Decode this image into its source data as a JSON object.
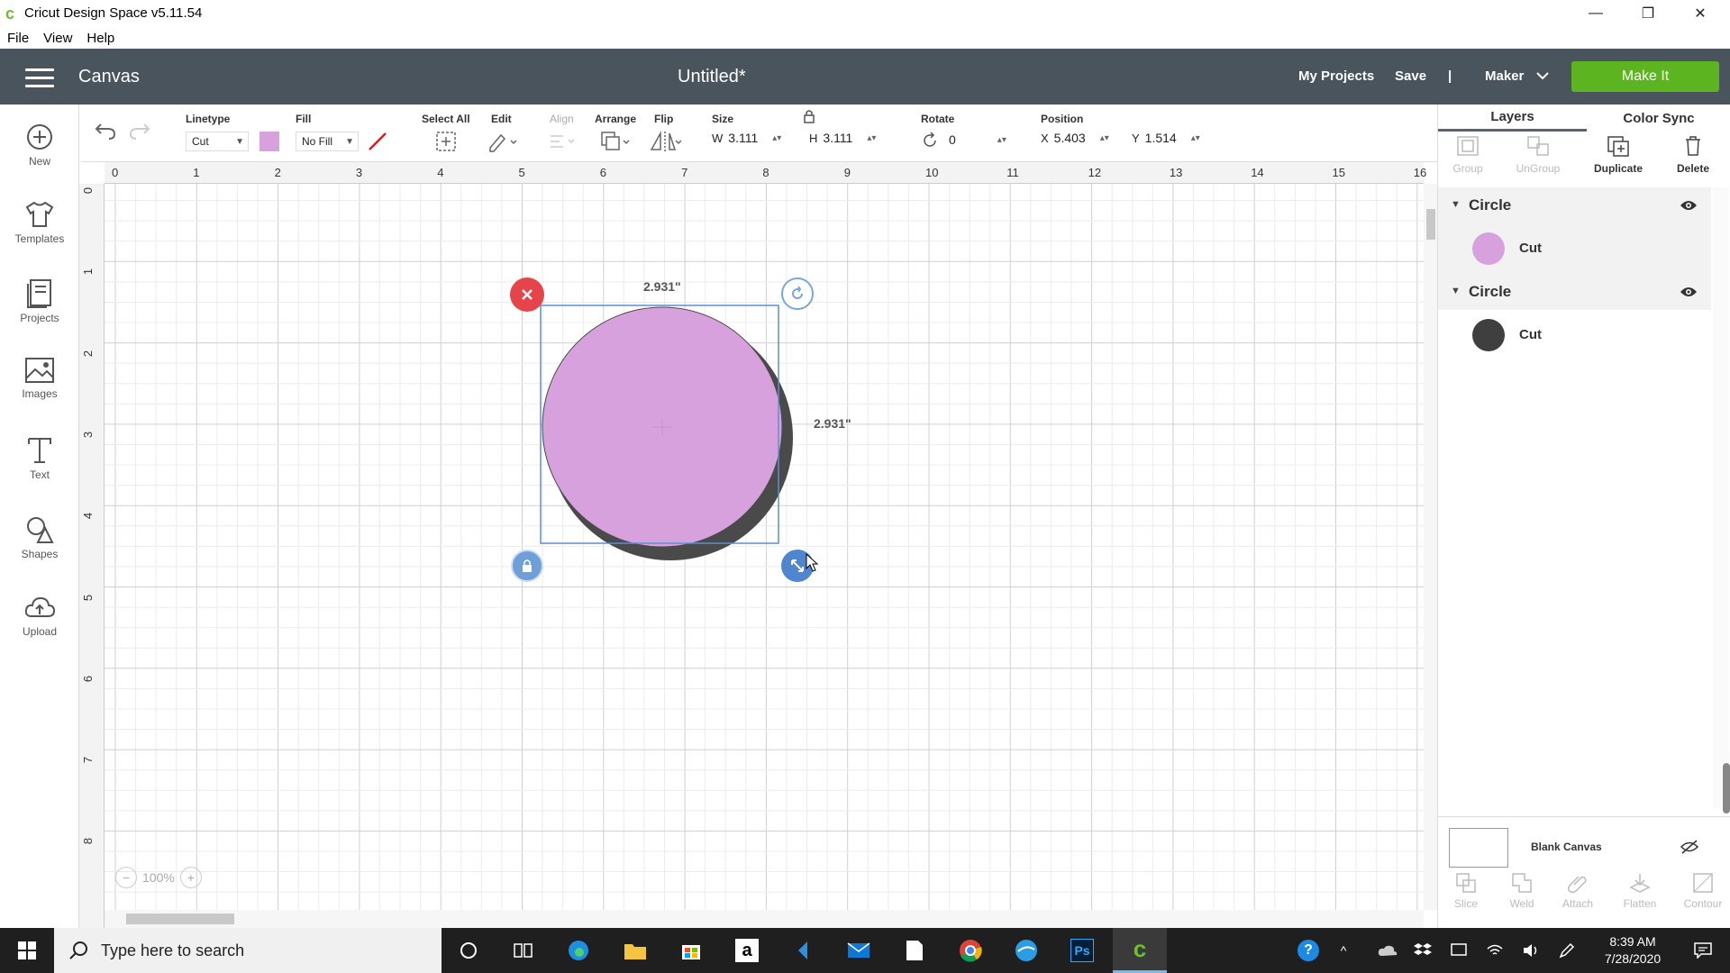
{
  "window": {
    "title": "Cricut Design Space  v5.11.54",
    "minimize": "—",
    "maximize": "❐",
    "close": "✕"
  },
  "menu": [
    "File",
    "View",
    "Help"
  ],
  "header": {
    "section": "Canvas",
    "doc_title": "Untitled*",
    "my_projects": "My Projects",
    "save": "Save",
    "separator": "|",
    "machine": "Maker",
    "make_it": "Make It"
  },
  "toolbar": {
    "linetype_label": "Linetype",
    "linetype_value": "Cut",
    "fill_label": "Fill",
    "fill_value": "No Fill",
    "select_all": "Select All",
    "edit": "Edit",
    "align": "Align",
    "arrange": "Arrange",
    "flip": "Flip",
    "size_label": "Size",
    "w_label": "W",
    "w_value": "3.111",
    "h_label": "H",
    "h_value": "3.111",
    "rotate_label": "Rotate",
    "rotate_value": "0",
    "position_label": "Position",
    "x_label": "X",
    "x_value": "5.403",
    "y_label": "Y",
    "y_value": "1.514",
    "colors": {
      "linetype_swatch": "#d6a1dd"
    }
  },
  "leftnav": [
    {
      "label": "New",
      "icon": "plus-circle-icon"
    },
    {
      "label": "Templates",
      "icon": "tshirt-icon"
    },
    {
      "label": "Projects",
      "icon": "projects-icon"
    },
    {
      "label": "Images",
      "icon": "image-icon"
    },
    {
      "label": "Text",
      "icon": "text-icon"
    },
    {
      "label": "Shapes",
      "icon": "shapes-icon"
    },
    {
      "label": "Upload",
      "icon": "upload-cloud-icon"
    }
  ],
  "ruler": {
    "h": [
      "0",
      "1",
      "2",
      "3",
      "4",
      "5",
      "6",
      "7",
      "8",
      "9",
      "10",
      "11",
      "12",
      "13",
      "14",
      "15",
      "16"
    ],
    "v": [
      "0",
      "1",
      "2",
      "3",
      "4",
      "5",
      "6",
      "7",
      "8"
    ]
  },
  "canvas": {
    "width_dim": "2.931\"",
    "height_dim": "2.931\"",
    "zoom": "100%",
    "colors": {
      "shape_fill": "#d6a1dd",
      "shadow": "#4a4a4a",
      "selection": "#5b8fd1",
      "delete_handle": "#e5444a"
    }
  },
  "rightpanel": {
    "tab_layers": "Layers",
    "tab_color_sync": "Color Sync",
    "tools_top": [
      {
        "label": "Group",
        "enabled": false
      },
      {
        "label": "UnGroup",
        "enabled": false
      },
      {
        "label": "Duplicate",
        "enabled": true
      },
      {
        "label": "Delete",
        "enabled": true
      }
    ],
    "layers": [
      {
        "name": "Circle",
        "op": "Cut",
        "color": "#d6a1dd"
      },
      {
        "name": "Circle",
        "op": "Cut",
        "color": "#3f3f3f"
      }
    ],
    "blank_canvas": "Blank Canvas",
    "tools_bottom": [
      {
        "label": "Slice"
      },
      {
        "label": "Weld"
      },
      {
        "label": "Attach"
      },
      {
        "label": "Flatten"
      },
      {
        "label": "Contour"
      }
    ]
  },
  "taskbar": {
    "search_placeholder": "Type here to search",
    "time": "8:39 AM",
    "date": "7/28/2020"
  }
}
